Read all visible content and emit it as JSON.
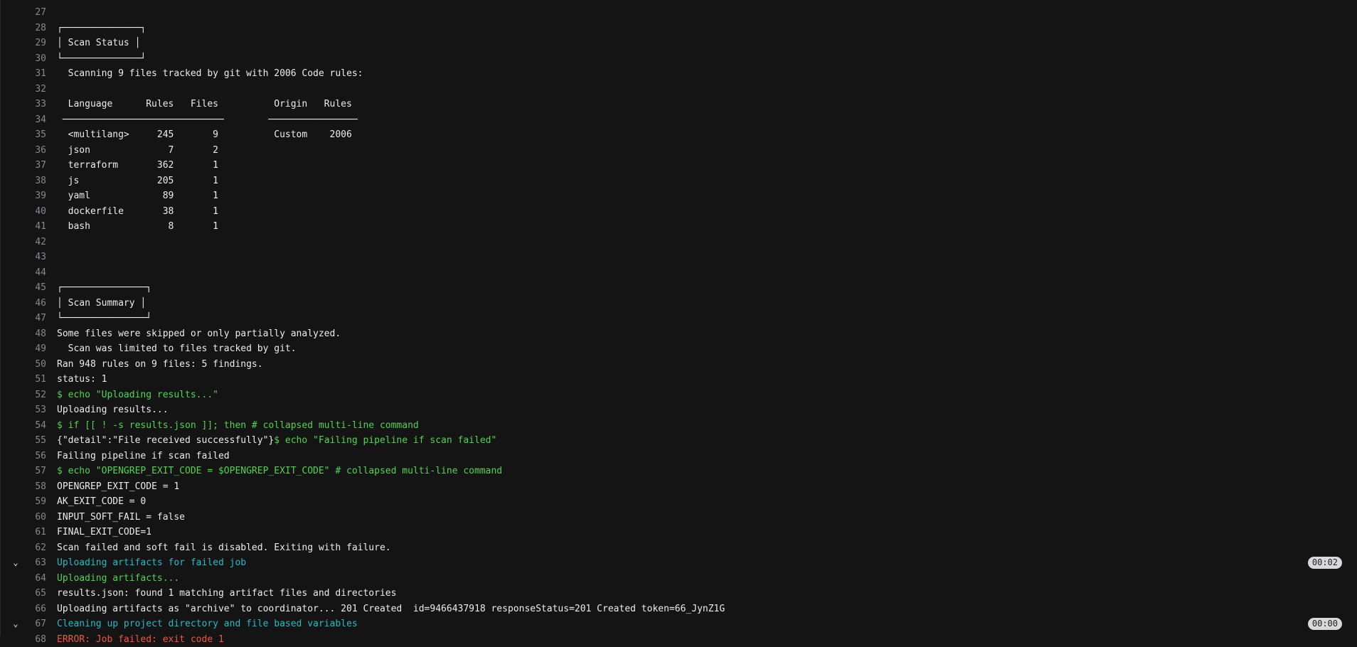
{
  "log_lines": [
    {
      "n": "27",
      "segments": [
        {
          "text": "",
          "color": "default"
        }
      ]
    },
    {
      "n": "28",
      "segments": [
        {
          "text": "┌──────────────┐",
          "color": "default"
        }
      ]
    },
    {
      "n": "29",
      "segments": [
        {
          "text": "│ Scan Status │",
          "color": "default"
        }
      ]
    },
    {
      "n": "30",
      "segments": [
        {
          "text": "└──────────────┘",
          "color": "default"
        }
      ]
    },
    {
      "n": "31",
      "segments": [
        {
          "text": "  Scanning 9 files tracked by git with 2006 Code rules:",
          "color": "default"
        }
      ]
    },
    {
      "n": "32",
      "segments": [
        {
          "text": "",
          "color": "default"
        }
      ]
    },
    {
      "n": "33",
      "segments": [
        {
          "text": "  Language      Rules   Files          Origin   Rules",
          "color": "default"
        }
      ]
    },
    {
      "n": "34",
      "segments": [
        {
          "text": " ─────────────────────────────        ────────────────",
          "color": "default"
        }
      ]
    },
    {
      "n": "35",
      "segments": [
        {
          "text": "  <multilang>     245       9          Custom    2006",
          "color": "default"
        }
      ]
    },
    {
      "n": "36",
      "segments": [
        {
          "text": "  json              7       2",
          "color": "default"
        }
      ]
    },
    {
      "n": "37",
      "segments": [
        {
          "text": "  terraform       362       1",
          "color": "default"
        }
      ]
    },
    {
      "n": "38",
      "segments": [
        {
          "text": "  js              205       1",
          "color": "default"
        }
      ]
    },
    {
      "n": "39",
      "segments": [
        {
          "text": "  yaml             89       1",
          "color": "default"
        }
      ]
    },
    {
      "n": "40",
      "segments": [
        {
          "text": "  dockerfile       38       1",
          "color": "default"
        }
      ]
    },
    {
      "n": "41",
      "segments": [
        {
          "text": "  bash              8       1",
          "color": "default"
        }
      ]
    },
    {
      "n": "42",
      "segments": [
        {
          "text": "",
          "color": "default"
        }
      ]
    },
    {
      "n": "43",
      "segments": [
        {
          "text": "",
          "color": "default"
        }
      ]
    },
    {
      "n": "44",
      "segments": [
        {
          "text": "",
          "color": "default"
        }
      ]
    },
    {
      "n": "45",
      "segments": [
        {
          "text": "┌───────────────┐",
          "color": "default"
        }
      ]
    },
    {
      "n": "46",
      "segments": [
        {
          "text": "│ Scan Summary │",
          "color": "default"
        }
      ]
    },
    {
      "n": "47",
      "segments": [
        {
          "text": "└───────────────┘",
          "color": "default"
        }
      ]
    },
    {
      "n": "48",
      "segments": [
        {
          "text": "Some files were skipped or only partially analyzed.",
          "color": "default"
        }
      ]
    },
    {
      "n": "49",
      "segments": [
        {
          "text": "  Scan was limited to files tracked by git.",
          "color": "default"
        }
      ]
    },
    {
      "n": "50",
      "segments": [
        {
          "text": "Ran 948 rules on 9 files: 5 findings.",
          "color": "default"
        }
      ]
    },
    {
      "n": "51",
      "segments": [
        {
          "text": "status: 1",
          "color": "default"
        }
      ]
    },
    {
      "n": "52",
      "segments": [
        {
          "text": "$ echo \"Uploading results...\"",
          "color": "green"
        }
      ]
    },
    {
      "n": "53",
      "segments": [
        {
          "text": "Uploading results...",
          "color": "default"
        }
      ]
    },
    {
      "n": "54",
      "segments": [
        {
          "text": "$ if [[ ! -s results.json ]]; then # collapsed multi-line command",
          "color": "green"
        }
      ]
    },
    {
      "n": "55",
      "segments": [
        {
          "text": "{\"detail\":\"File received successfully\"}",
          "color": "default"
        },
        {
          "text": "$ echo \"Failing pipeline if scan failed\"",
          "color": "green"
        }
      ]
    },
    {
      "n": "56",
      "segments": [
        {
          "text": "Failing pipeline if scan failed",
          "color": "default"
        }
      ]
    },
    {
      "n": "57",
      "segments": [
        {
          "text": "$ echo \"OPENGREP_EXIT_CODE = $OPENGREP_EXIT_CODE\" # collapsed multi-line command",
          "color": "green"
        }
      ]
    },
    {
      "n": "58",
      "segments": [
        {
          "text": "OPENGREP_EXIT_CODE = 1",
          "color": "default"
        }
      ]
    },
    {
      "n": "59",
      "segments": [
        {
          "text": "AK_EXIT_CODE = 0",
          "color": "default"
        }
      ]
    },
    {
      "n": "60",
      "segments": [
        {
          "text": "INPUT_SOFT_FAIL = false",
          "color": "default"
        }
      ]
    },
    {
      "n": "61",
      "segments": [
        {
          "text": "FINAL_EXIT_CODE=1",
          "color": "default"
        }
      ]
    },
    {
      "n": "62",
      "segments": [
        {
          "text": "Scan failed and soft fail is disabled. Exiting with failure.",
          "color": "default"
        }
      ]
    },
    {
      "n": "63",
      "segments": [
        {
          "text": "Uploading artifacts for failed job",
          "color": "cyan"
        }
      ],
      "section": true,
      "duration": "00:02"
    },
    {
      "n": "64",
      "segments": [
        {
          "text": "Uploading artifacts...",
          "color": "green"
        }
      ]
    },
    {
      "n": "65",
      "segments": [
        {
          "text": "results.json: found 1 matching artifact files and directories",
          "color": "default"
        }
      ]
    },
    {
      "n": "66",
      "segments": [
        {
          "text": "Uploading artifacts as \"archive\" to coordinator... 201 Created  id=9466437918 responseStatus=201 Created token=66_JynZ1G",
          "color": "default"
        }
      ]
    },
    {
      "n": "67",
      "segments": [
        {
          "text": "Cleaning up project directory and file based variables",
          "color": "cyan"
        }
      ],
      "section": true,
      "duration": "00:00"
    },
    {
      "n": "68",
      "segments": [
        {
          "text": "ERROR: Job failed: exit code 1",
          "color": "red"
        }
      ]
    }
  ],
  "icons": {
    "section_toggle": "chevron-down-icon"
  },
  "colors": {
    "background": "#141414",
    "text": "#ececef",
    "line_number": "#89888d",
    "command_green": "#52d352",
    "section_cyan": "#29b8c7",
    "error_red": "#ec5941",
    "duration_badge": "#d9d9dc"
  }
}
